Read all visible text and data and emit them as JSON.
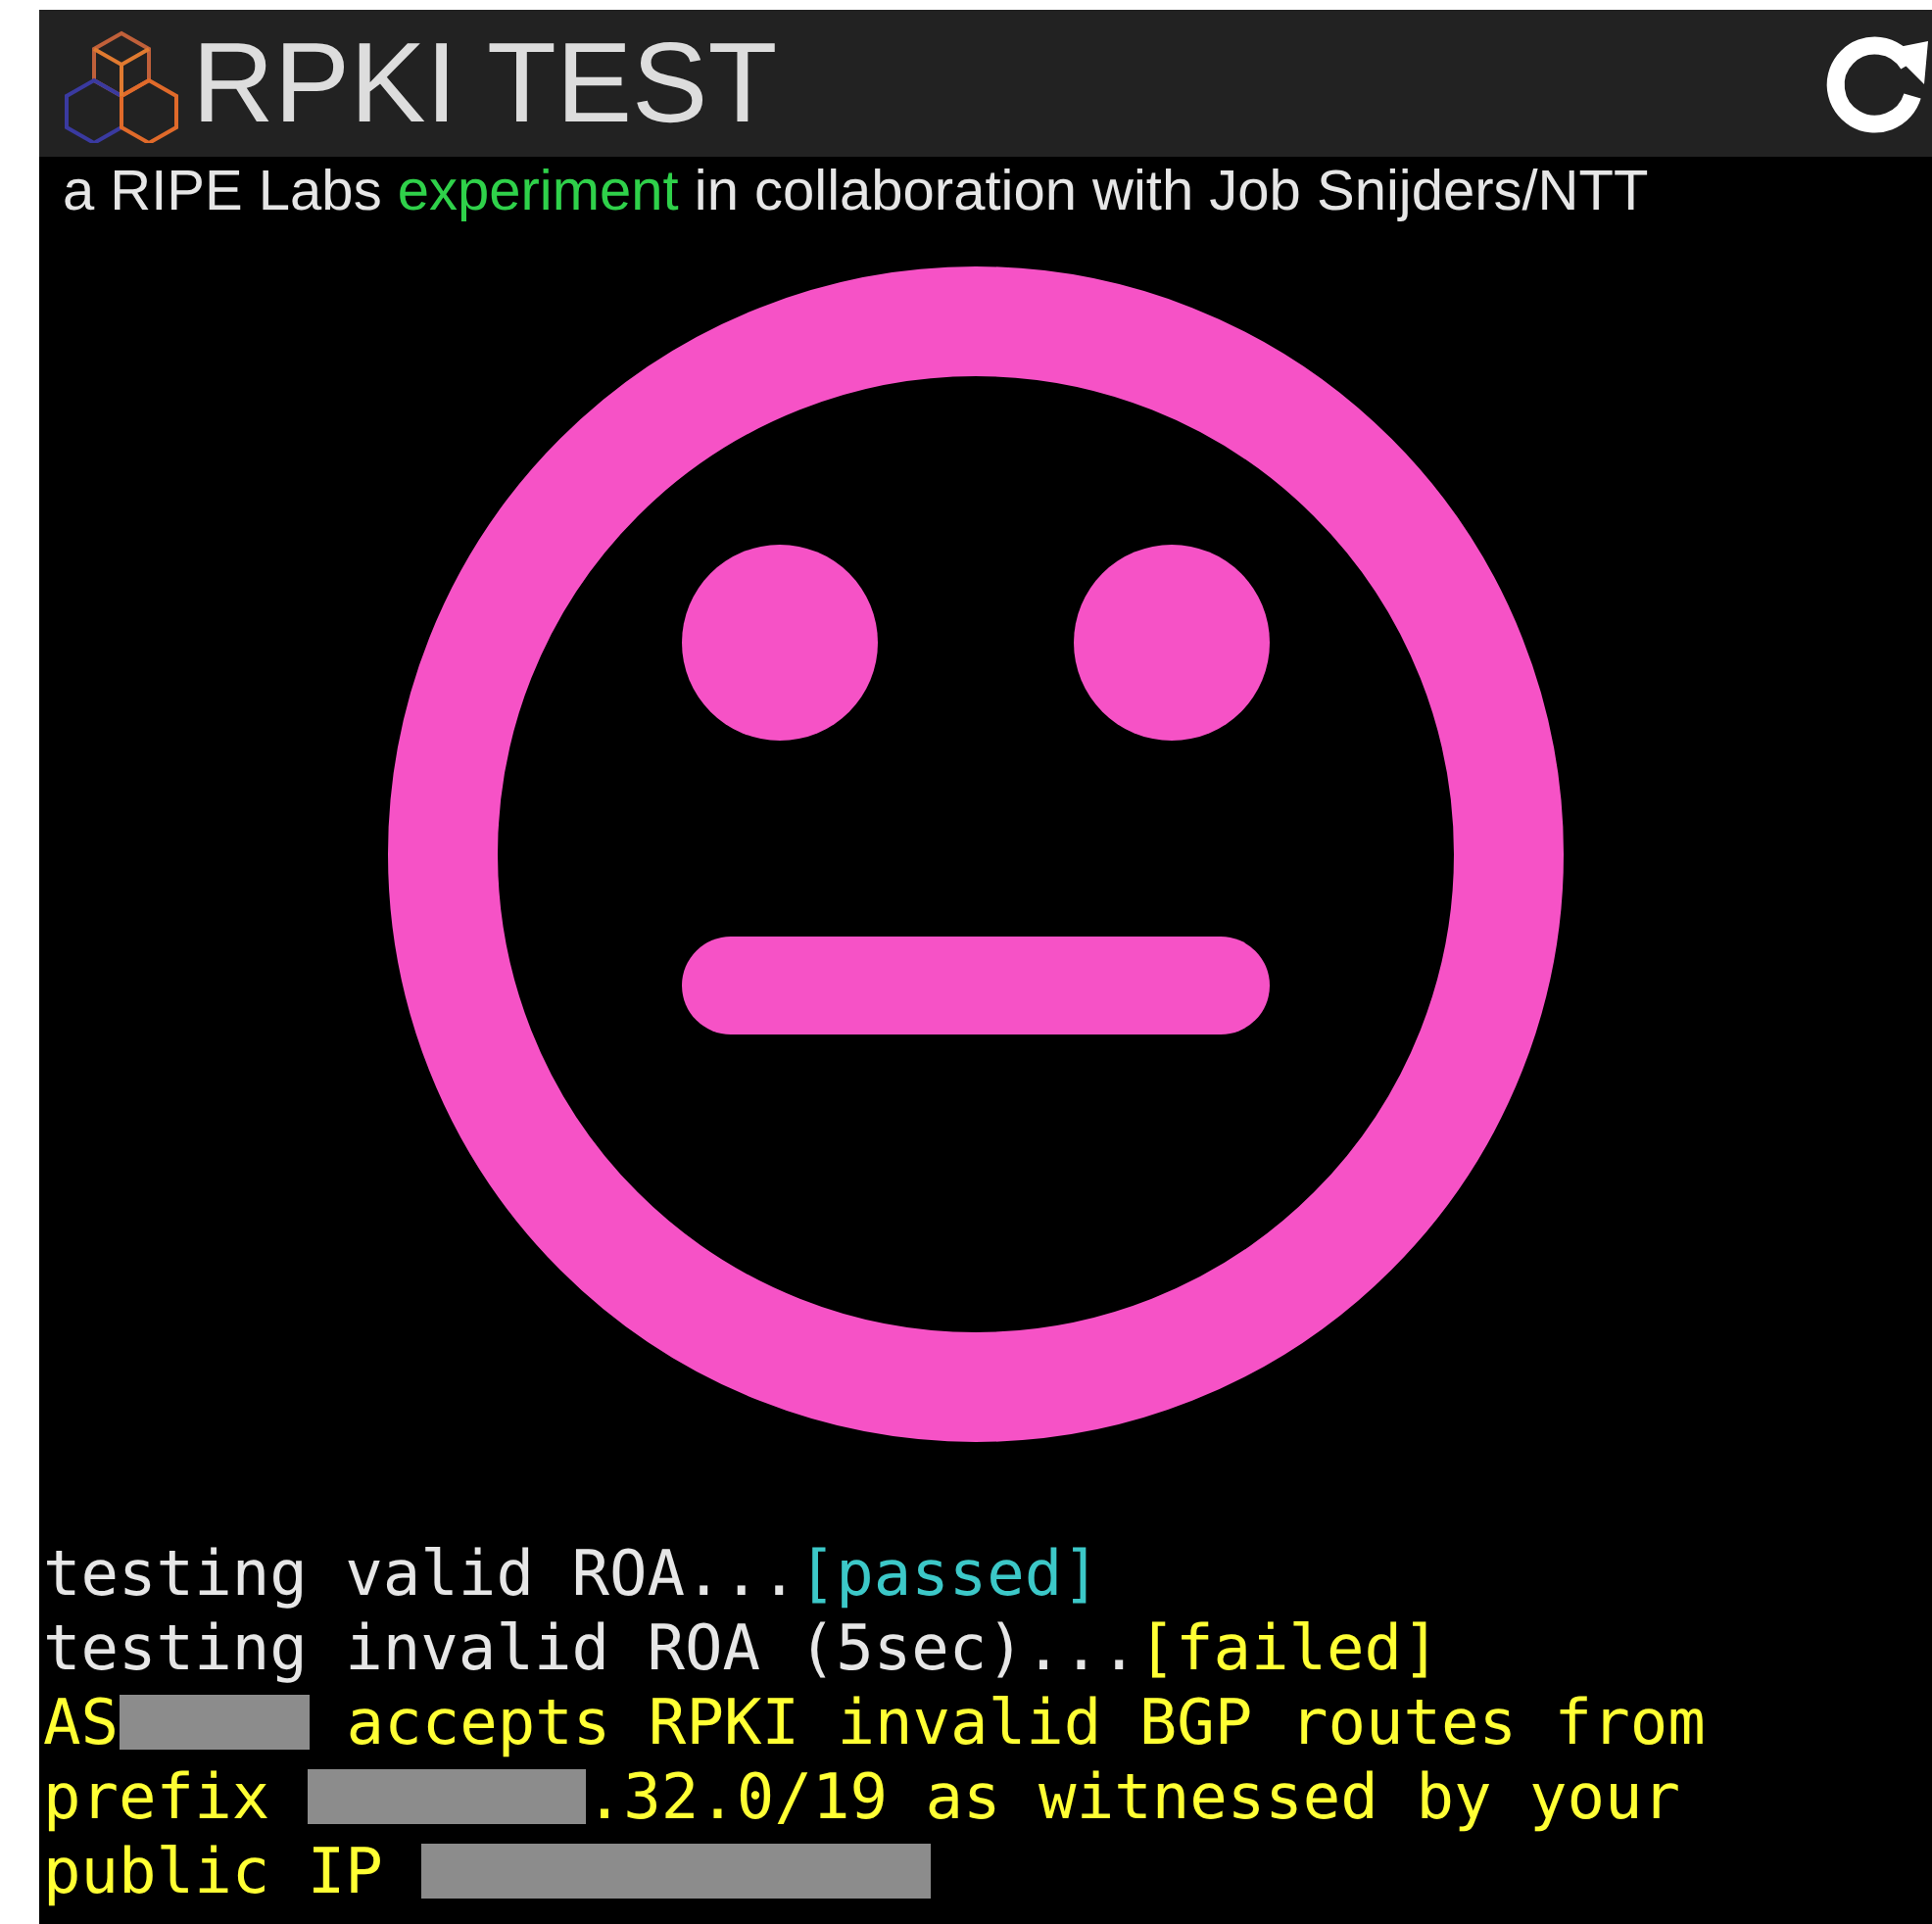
{
  "header": {
    "title": "RPKI TEST"
  },
  "subtitle": [
    {
      "kind": "text",
      "text": "a RIPE Labs "
    },
    {
      "kind": "link",
      "text": "experiment"
    },
    {
      "kind": "text",
      "text": " in collaboration with Job Snijders/NTT"
    }
  ],
  "face": {
    "kind": "neutral"
  },
  "tests": [
    {
      "text": "testing valid ROA...",
      "result": "[passed]",
      "passed": true
    },
    {
      "text": "testing invalid ROA (5sec)...",
      "result": "[failed]",
      "passed": false
    }
  ],
  "verdict": [
    [
      {
        "kind": "text",
        "text": "AS"
      },
      {
        "kind": "redacted"
      },
      {
        "kind": "text",
        "text": " accepts RPKI invalid BGP routes from"
      }
    ],
    [
      {
        "kind": "text",
        "text": "prefix "
      },
      {
        "kind": "redacted"
      },
      {
        "kind": "text",
        "text": ".32.0/19 as witnessed by your"
      }
    ],
    [
      {
        "kind": "text",
        "text": "public IP "
      },
      {
        "kind": "redacted"
      }
    ]
  ]
}
